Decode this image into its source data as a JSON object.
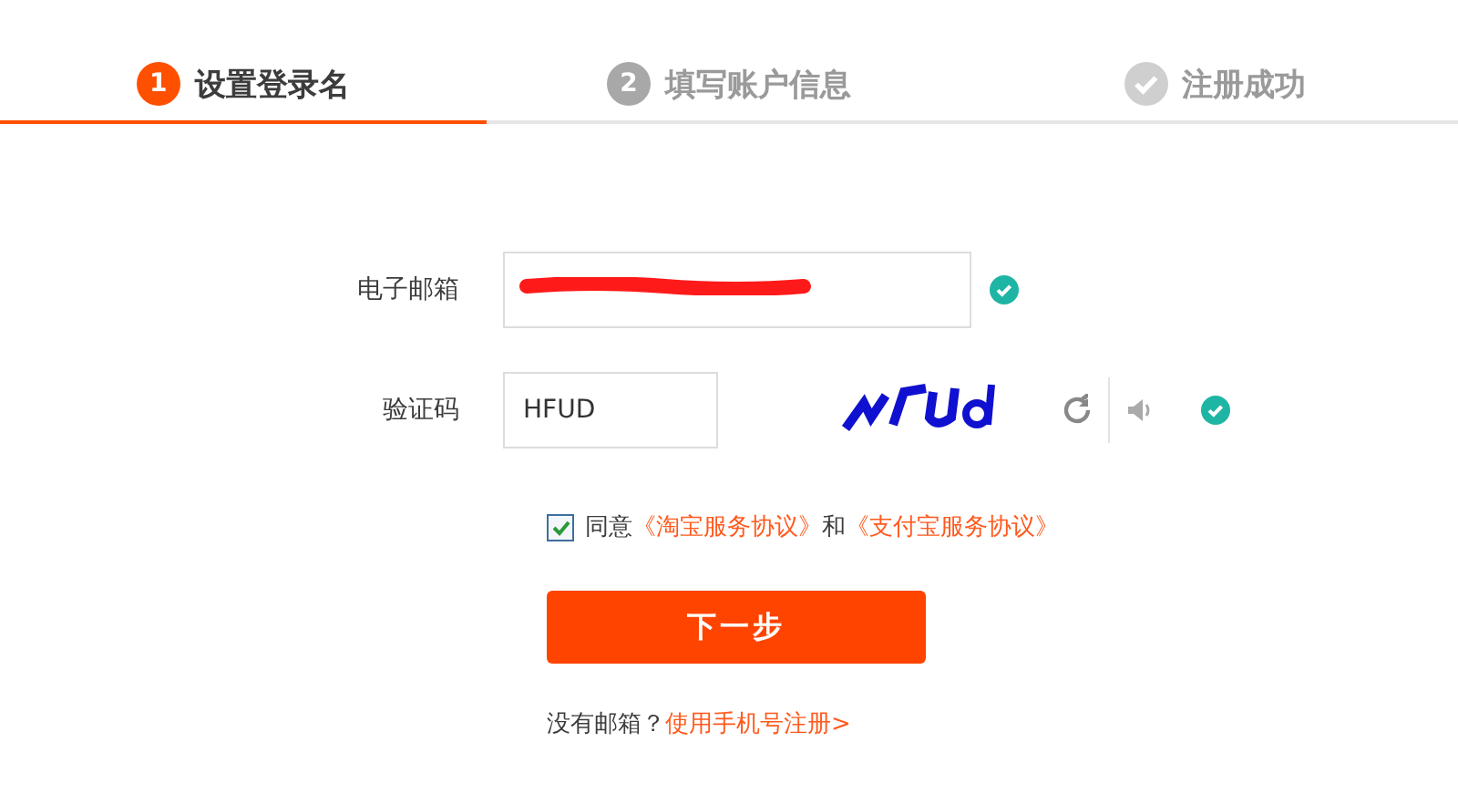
{
  "steps": [
    {
      "kind": "number",
      "marker": "1",
      "label": "设置登录名",
      "selected": true
    },
    {
      "kind": "number",
      "marker": "2",
      "label": "填写账户信息",
      "selected": false
    },
    {
      "kind": "check",
      "label": "注册成功",
      "selected": false
    }
  ],
  "form": {
    "email": {
      "label": "电子邮箱",
      "redacted": true,
      "valid": true
    },
    "captcha": {
      "label": "验证码",
      "value": "HFUD",
      "valid": true
    }
  },
  "agreement": {
    "checked": true,
    "prefix": "同意",
    "links": [
      "《淘宝服务协议》",
      "《支付宝服务协议》"
    ],
    "joiner": "和"
  },
  "submit": "下一步",
  "footer": {
    "text": "没有邮箱？",
    "link": "使用手机号注册>"
  }
}
